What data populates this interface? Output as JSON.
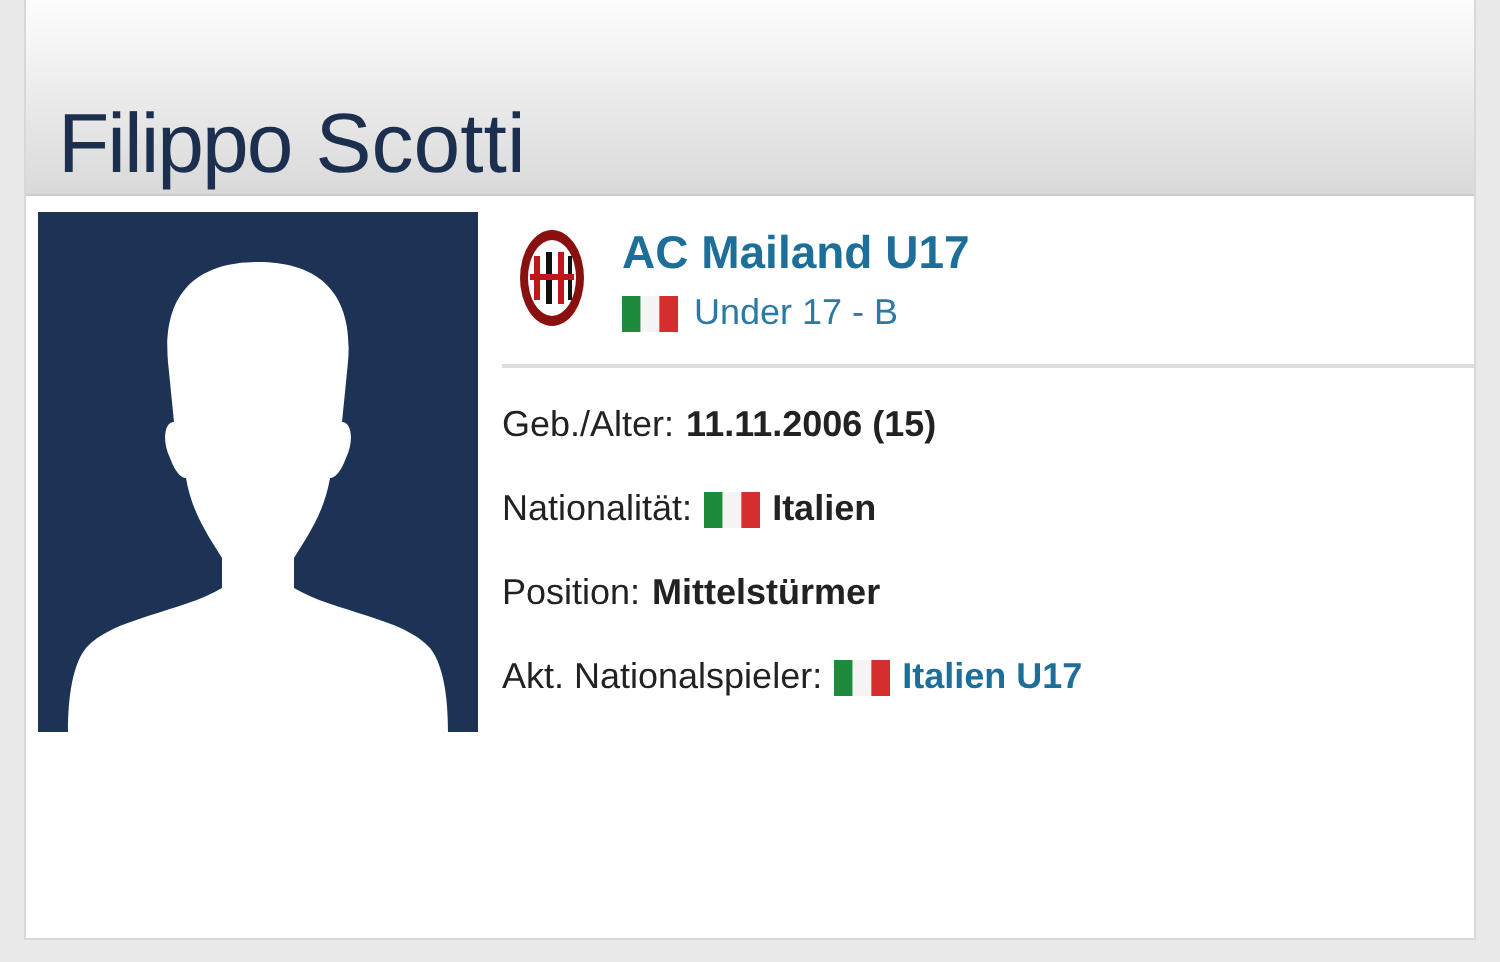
{
  "header": {
    "first_name": "Filippo",
    "last_name": "Scotti"
  },
  "club": {
    "name": "AC Mailand U17",
    "league": "Under 17 - B",
    "league_flag": true
  },
  "details": [
    {
      "label": "Geb./Alter:",
      "value": "11.11.2006 (15)",
      "flag": false,
      "kind": "bold"
    },
    {
      "label": "Nationalität:",
      "value": "Italien",
      "flag": true,
      "kind": "bold"
    },
    {
      "label": "Position:",
      "value": "Mittelstürmer",
      "flag": false,
      "kind": "bold"
    },
    {
      "label": "Akt. Nationalspieler:",
      "value": "Italien U17",
      "flag": true,
      "kind": "link"
    }
  ]
}
